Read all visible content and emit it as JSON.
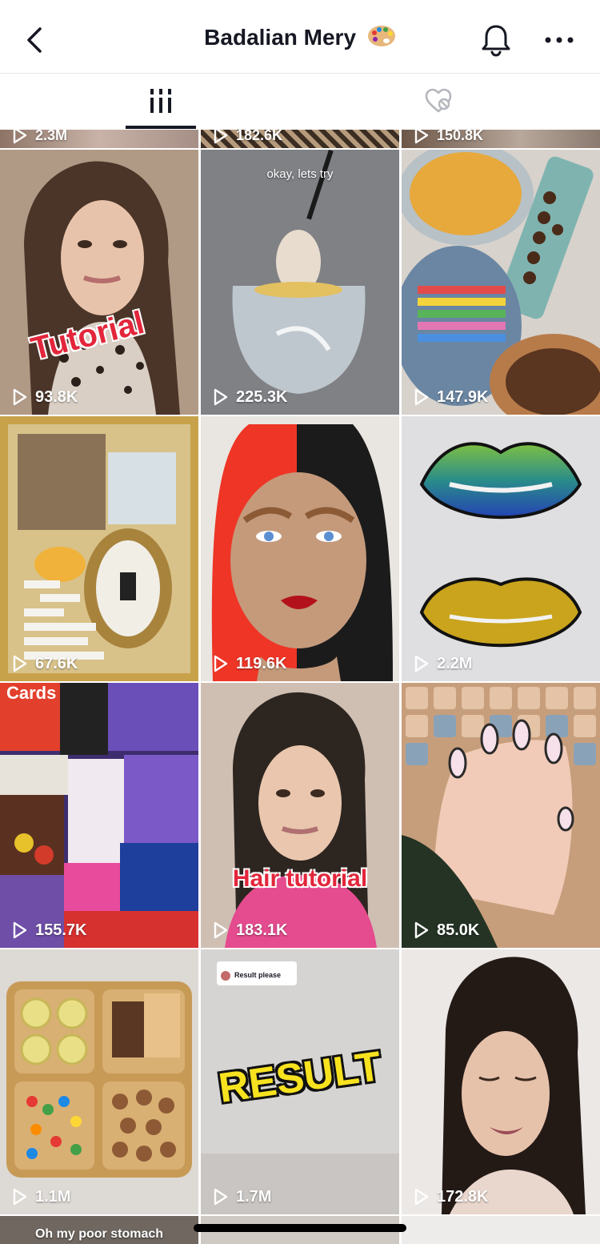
{
  "header": {
    "title": "Badalian Mery",
    "title_emoji": "palette-icon"
  },
  "tabs": [
    {
      "name": "videos",
      "icon": "grid-icon",
      "selected": true
    },
    {
      "name": "liked",
      "icon": "liked-hidden-icon",
      "selected": false
    }
  ],
  "partial_top_row": [
    "2.3M",
    "182.6K",
    "150.8K"
  ],
  "videos": [
    {
      "views": "93.8K",
      "caption": "Tutorial"
    },
    {
      "views": "225.3K",
      "caption": "okay, lets try"
    },
    {
      "views": "147.9K",
      "caption": ""
    },
    {
      "views": "67.6K",
      "caption": ""
    },
    {
      "views": "119.6K",
      "caption": ""
    },
    {
      "views": "2.2M",
      "caption": ""
    },
    {
      "views": "155.7K",
      "caption": ""
    },
    {
      "views": "183.1K",
      "caption": "Hair tutorial"
    },
    {
      "views": "85.0K",
      "caption": ""
    },
    {
      "views": "1.1M",
      "caption": ""
    },
    {
      "views": "1.7M",
      "caption": "RESULT",
      "reply_badge": "Result please"
    },
    {
      "views": "172.8K",
      "caption": ""
    }
  ],
  "partial_bottom_row": {
    "caption": "Oh my poor stomach"
  },
  "colors": {
    "text_primary": "#161823",
    "divider": "#e6e6e6",
    "tutorial_red": "#e3263b"
  }
}
